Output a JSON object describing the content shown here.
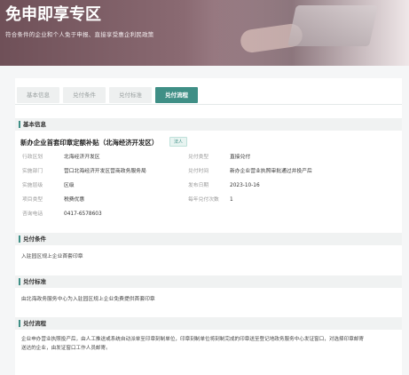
{
  "banner": {
    "title": "免申即享专区",
    "subtitle": "符合条件的企业和个人免于申报、直接享受惠企利民政策"
  },
  "tabs": [
    {
      "label": "基本信息",
      "active": false
    },
    {
      "label": "兑付条件",
      "active": false
    },
    {
      "label": "兑付标准",
      "active": false
    },
    {
      "label": "兑付流程",
      "active": true
    }
  ],
  "basic": {
    "header": "基本信息",
    "policy_name": "新办企业首套印章定额补贴（北海经济开发区）",
    "badge": "法人",
    "fields": {
      "region": {
        "key": "行政区划",
        "value": "北海经济开发区"
      },
      "pay_type": {
        "key": "兑付类型",
        "value": "直接兑付"
      },
      "dept": {
        "key": "实施部门",
        "value": "营口北海经济开发区营商政务服务局"
      },
      "pay_time": {
        "key": "兑付时间",
        "value": "新办企业营业执照审批通过并投产后"
      },
      "level": {
        "key": "实施层级",
        "value": "区级"
      },
      "date": {
        "key": "发布日期",
        "value": "2023-10-16"
      },
      "category": {
        "key": "项目类型",
        "value": "税费优惠"
      },
      "times": {
        "key": "每年兑付次数",
        "value": "1"
      },
      "phone": {
        "key": "咨询电话",
        "value": "0417-6578603"
      }
    }
  },
  "condition": {
    "header": "兑付条件",
    "text": "入驻园区规上企业首套印章"
  },
  "standard": {
    "header": "兑付标准",
    "text": "由北海政务服务中心为入驻园区规上企业免费提供首套印章"
  },
  "process": {
    "header": "兑付流程",
    "line1": "企业申办营业执照投产后，由人工推送或系统自动派单至印章刻制单位，印章刻制单位将刻制完成的印章送至登记地政务服务中心发证窗口，对选择印章邮寄",
    "line2": "送达的企业，由发证窗口工作人员邮寄。"
  },
  "colors": {
    "accent": "#3f8f86",
    "banner": "#7a5c64"
  }
}
